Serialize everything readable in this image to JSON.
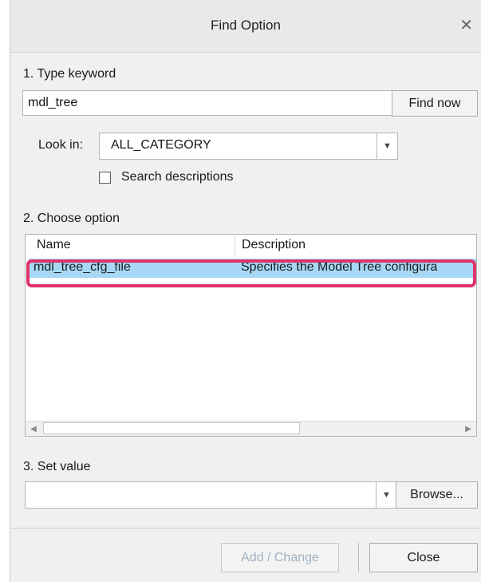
{
  "window": {
    "title": "Find Option",
    "close_glyph": "✕"
  },
  "step1": {
    "label": "1. Type keyword",
    "keyword_value": "mdl_tree",
    "find_button": "Find now",
    "look_in_label": "Look in:",
    "look_in_value": "ALL_CATEGORY",
    "search_desc_label": "Search descriptions",
    "search_desc_checked": false
  },
  "step2": {
    "label": "2. Choose option",
    "columns": [
      "Name",
      "Description"
    ],
    "rows": [
      {
        "name": "mdl_tree_cfg_file",
        "description": "Specifies the Model Tree configura",
        "selected": true
      }
    ]
  },
  "step3": {
    "label": "3. Set value",
    "value": "",
    "browse_button": "Browse..."
  },
  "footer": {
    "add_change_button": "Add / Change",
    "close_button": "Close"
  },
  "colors": {
    "selection": "#a6d8f5",
    "highlight_ring": "#e0336a",
    "disabled_text": "#9fb0c4"
  },
  "icons": {
    "close": "close-icon",
    "dropdown": "chevron-down-icon",
    "scroll_left": "arrow-left-icon",
    "scroll_right": "arrow-right-icon"
  }
}
